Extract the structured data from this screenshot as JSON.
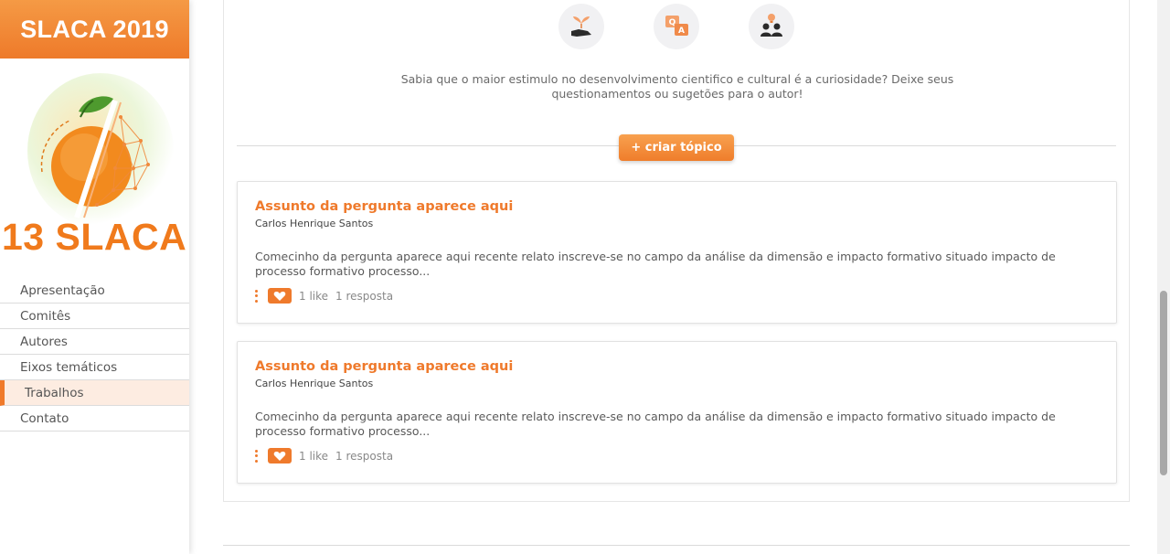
{
  "sidebar": {
    "brand_title": "SLACA 2019",
    "logo_text": "13 SLACA",
    "nav": [
      {
        "label": "Apresentação",
        "active": false
      },
      {
        "label": "Comitês",
        "active": false
      },
      {
        "label": "Autores",
        "active": false
      },
      {
        "label": "Eixos temáticos",
        "active": false
      },
      {
        "label": "Trabalhos",
        "active": true
      },
      {
        "label": "Contato",
        "active": false
      }
    ]
  },
  "main": {
    "topic_icons": [
      "hand-plant-icon",
      "qa-bubbles-icon",
      "people-idea-icon"
    ],
    "intro_text": "Sabia que o maior estimulo no desenvolvimento cientifico e cultural é a curiosidade? Deixe seus questionamentos ou sugetões para o autor!",
    "create_topic_label": "+ criar tópico",
    "topics": [
      {
        "title": "Assunto da pergunta aparece aqui",
        "author": "Carlos Henrique Santos",
        "excerpt": "Comecinho da pergunta aparece aqui recente relato inscreve-se no campo da análise da dimensão e impacto formativo situado impacto de processo formativo processo...",
        "likes": "1 like",
        "replies": "1 resposta"
      },
      {
        "title": "Assunto da pergunta aparece aqui",
        "author": "Carlos Henrique Santos",
        "excerpt": "Comecinho da pergunta aparece aqui recente relato inscreve-se no campo da análise da dimensão e impacto formativo situado impacto de processo formativo processo...",
        "likes": "1 like",
        "replies": "1 resposta"
      }
    ]
  },
  "colors": {
    "accent": "#ef7a2c",
    "accent_light": "#f8a14f",
    "active_nav_bg": "#fdece1"
  }
}
